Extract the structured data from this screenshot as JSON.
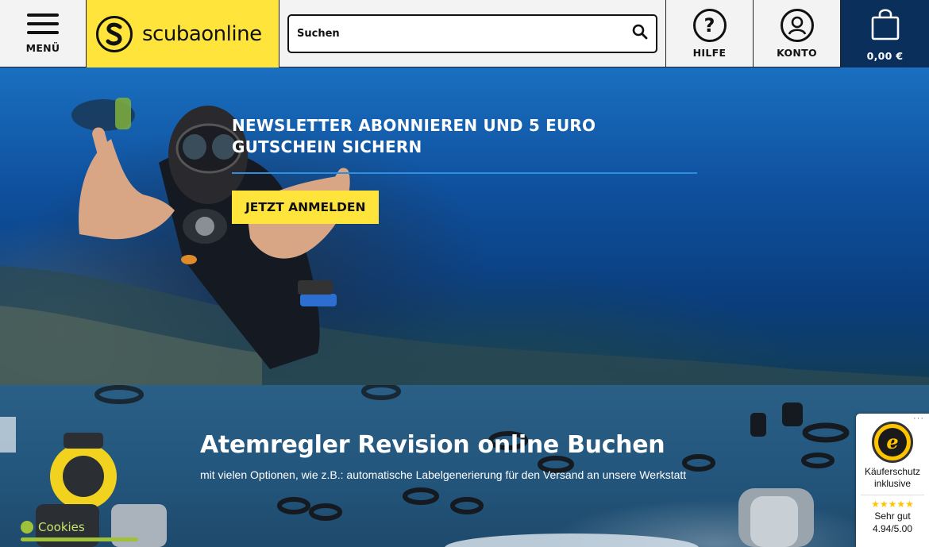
{
  "header": {
    "menu_label": "MENÜ",
    "logo_text": "scubaonline",
    "search_placeholder": "Suchen",
    "help_label": "HILFE",
    "account_label": "KONTO",
    "cart_total": "0,00 €"
  },
  "hero_newsletter": {
    "title_line1": "NEWSLETTER ABONNIEREN UND 5 EURO",
    "title_line2": "GUTSCHEIN SICHERN",
    "button_label": "JETZT ANMELDEN"
  },
  "hero_revision": {
    "title": "Atemregler Revision online Buchen",
    "subtitle": "mit vielen Optionen, wie z.B.: automatische Labelgenerierung für den Versand an unsere Werkstatt"
  },
  "trusted_shops": {
    "seal_letter": "e",
    "protection_line1": "Käuferschutz",
    "protection_line2": "inklusive",
    "stars": "★★★★★",
    "rating_text": "Sehr gut",
    "rating_value": "4.94/5.00"
  },
  "cookies": {
    "label": "Cookies"
  },
  "colors": {
    "brand_yellow": "#ffe53b",
    "cart_navy": "#0b2f5b",
    "accent_blue_line": "#2e8fe0"
  }
}
